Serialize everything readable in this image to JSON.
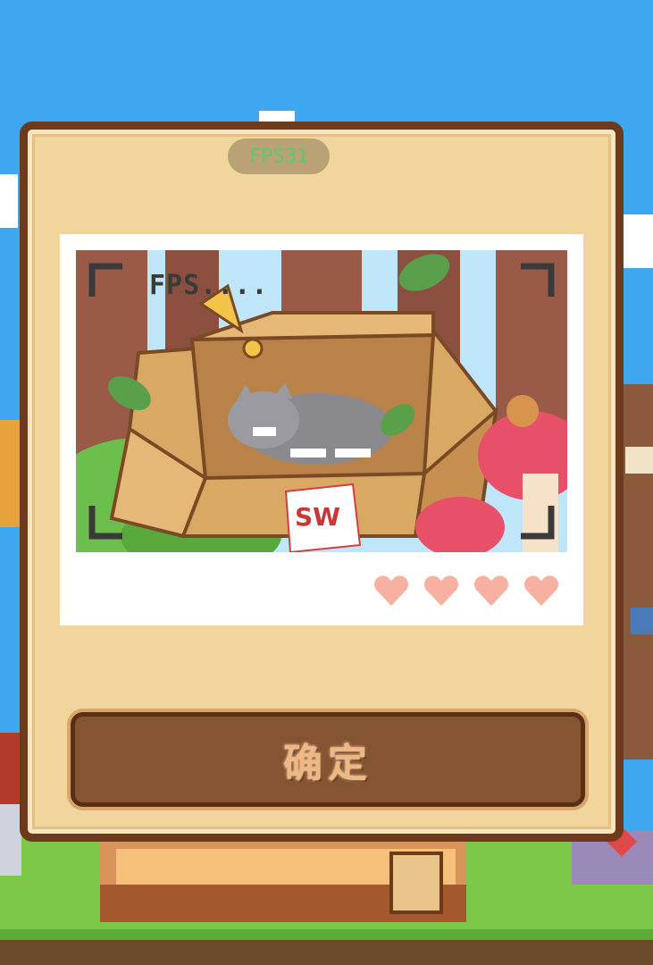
{
  "hud": {
    "fps_text": "FPS31"
  },
  "photo": {
    "caption": "FPS....",
    "stamp_text": "SW",
    "hearts_total": 4,
    "heart_color": "#f8b0a0"
  },
  "dialog": {
    "confirm_label": "确定"
  },
  "colors": {
    "sky": "#3fa7ef",
    "grass": "#7cc94a",
    "dialog_fill": "#f2d59c",
    "dialog_border": "#6e3a1c",
    "button_fill": "#845433"
  }
}
